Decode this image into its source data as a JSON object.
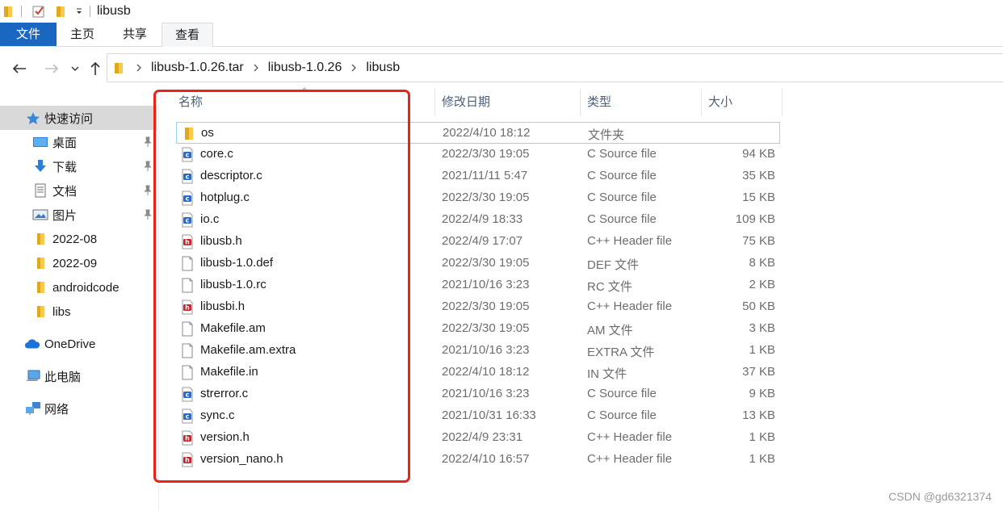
{
  "window": {
    "title": "libusb"
  },
  "ribbon": {
    "tabs": [
      "文件",
      "主页",
      "共享",
      "查看"
    ]
  },
  "address": {
    "crumbs": [
      "libusb-1.0.26.tar",
      "libusb-1.0.26",
      "libusb"
    ]
  },
  "sidebar": {
    "quick_access": "快速访问",
    "items": [
      {
        "label": "桌面",
        "icon": "desktop-icon",
        "pinned": true
      },
      {
        "label": "下载",
        "icon": "download-icon",
        "pinned": true
      },
      {
        "label": "文档",
        "icon": "document-icon",
        "pinned": true
      },
      {
        "label": "图片",
        "icon": "picture-icon",
        "pinned": true
      },
      {
        "label": "2022-08",
        "icon": "folder-icon",
        "pinned": false
      },
      {
        "label": "2022-09",
        "icon": "folder-icon",
        "pinned": false
      },
      {
        "label": "androidcode",
        "icon": "folder-icon",
        "pinned": false
      },
      {
        "label": "libs",
        "icon": "folder-icon",
        "pinned": false
      }
    ],
    "onedrive": "OneDrive",
    "this_pc": "此电脑",
    "network": "网络"
  },
  "columns": {
    "name": "名称",
    "date": "修改日期",
    "type": "类型",
    "size": "大小"
  },
  "files": [
    {
      "name": "os",
      "date": "2022/4/10 18:12",
      "type": "文件夹",
      "size": "",
      "icon": "folder-icon"
    },
    {
      "name": "core.c",
      "date": "2022/3/30 19:05",
      "type": "C Source file",
      "size": "94 KB",
      "icon": "c-source-icon"
    },
    {
      "name": "descriptor.c",
      "date": "2021/11/11 5:47",
      "type": "C Source file",
      "size": "35 KB",
      "icon": "c-source-icon"
    },
    {
      "name": "hotplug.c",
      "date": "2022/3/30 19:05",
      "type": "C Source file",
      "size": "15 KB",
      "icon": "c-source-icon"
    },
    {
      "name": "io.c",
      "date": "2022/4/9 18:33",
      "type": "C Source file",
      "size": "109 KB",
      "icon": "c-source-icon"
    },
    {
      "name": "libusb.h",
      "date": "2022/4/9 17:07",
      "type": "C++ Header file",
      "size": "75 KB",
      "icon": "header-icon"
    },
    {
      "name": "libusb-1.0.def",
      "date": "2022/3/30 19:05",
      "type": "DEF 文件",
      "size": "8 KB",
      "icon": "file-icon"
    },
    {
      "name": "libusb-1.0.rc",
      "date": "2021/10/16 3:23",
      "type": "RC 文件",
      "size": "2 KB",
      "icon": "file-icon"
    },
    {
      "name": "libusbi.h",
      "date": "2022/3/30 19:05",
      "type": "C++ Header file",
      "size": "50 KB",
      "icon": "header-icon"
    },
    {
      "name": "Makefile.am",
      "date": "2022/3/30 19:05",
      "type": "AM 文件",
      "size": "3 KB",
      "icon": "file-icon"
    },
    {
      "name": "Makefile.am.extra",
      "date": "2021/10/16 3:23",
      "type": "EXTRA 文件",
      "size": "1 KB",
      "icon": "file-icon"
    },
    {
      "name": "Makefile.in",
      "date": "2022/4/10 18:12",
      "type": "IN 文件",
      "size": "37 KB",
      "icon": "file-icon"
    },
    {
      "name": "strerror.c",
      "date": "2021/10/16 3:23",
      "type": "C Source file",
      "size": "9 KB",
      "icon": "c-source-icon"
    },
    {
      "name": "sync.c",
      "date": "2021/10/31 16:33",
      "type": "C Source file",
      "size": "13 KB",
      "icon": "c-source-icon"
    },
    {
      "name": "version.h",
      "date": "2022/4/9 23:31",
      "type": "C++ Header file",
      "size": "1 KB",
      "icon": "header-icon"
    },
    {
      "name": "version_nano.h",
      "date": "2022/4/10 16:57",
      "type": "C++ Header file",
      "size": "1 KB",
      "icon": "header-icon"
    }
  ],
  "watermark": "CSDN @gd6321374",
  "colors": {
    "ribbon_file_tab": "#1a67c2",
    "selection_border": "#99d1ff",
    "annotation_red": "#e8231a",
    "folder_yellow": "#f8c94a"
  }
}
